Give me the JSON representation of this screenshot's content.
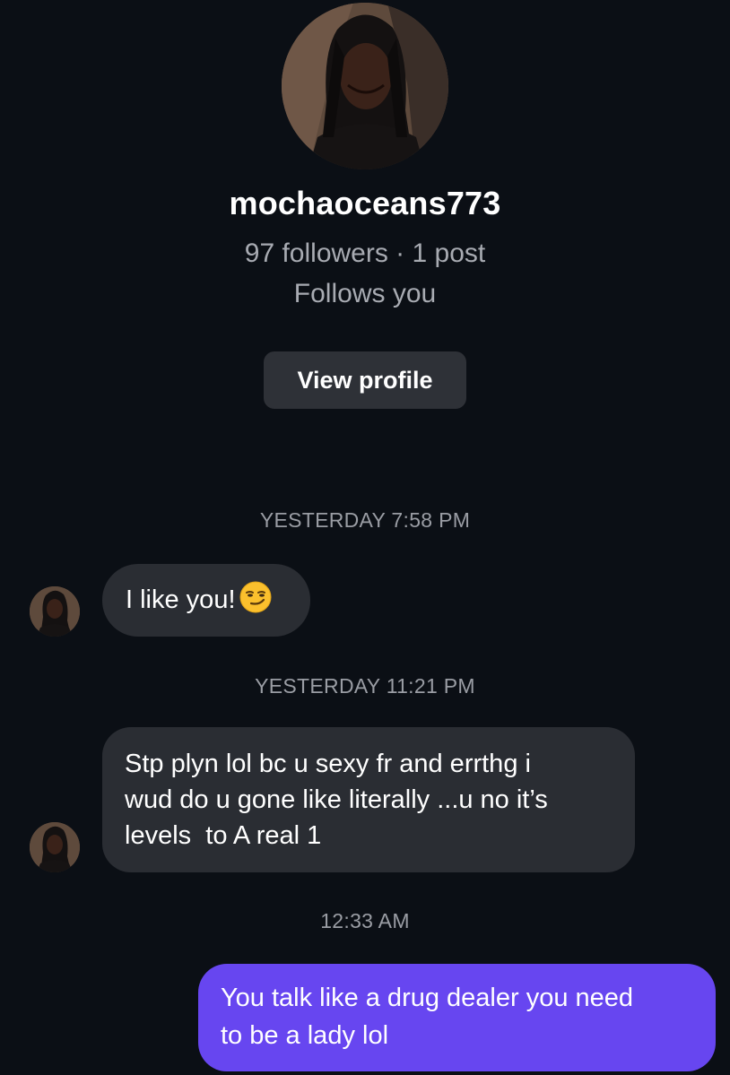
{
  "profile": {
    "username": "mochaoceans773",
    "stats": "97 followers · 1 post",
    "follows_you": "Follows you",
    "view_profile_label": "View profile"
  },
  "conversation": {
    "timestamps": [
      "YESTERDAY 7:58 PM",
      "YESTERDAY 11:21 PM",
      "12:33 AM"
    ],
    "messages": [
      {
        "sender": "mochaoceans773",
        "lines": [
          "I like you!"
        ],
        "emoji": "smirking-face"
      },
      {
        "sender": "mochaoceans773",
        "lines": [
          "Stp plyn lol bc u sexy fr and errthg i",
          "wud do u gone like literally ...u no it’s",
          "levels  to A real 1"
        ]
      },
      {
        "sender": "me",
        "lines": [
          "You talk like a drug dealer you need",
          "to be a lady lol"
        ]
      }
    ]
  },
  "colors": {
    "background": "#0b0f15",
    "incoming_bubble": "#2a2d33",
    "outgoing_bubble": "#6746f0",
    "secondary_text": "#a8abb2",
    "button": "#2e3137"
  }
}
